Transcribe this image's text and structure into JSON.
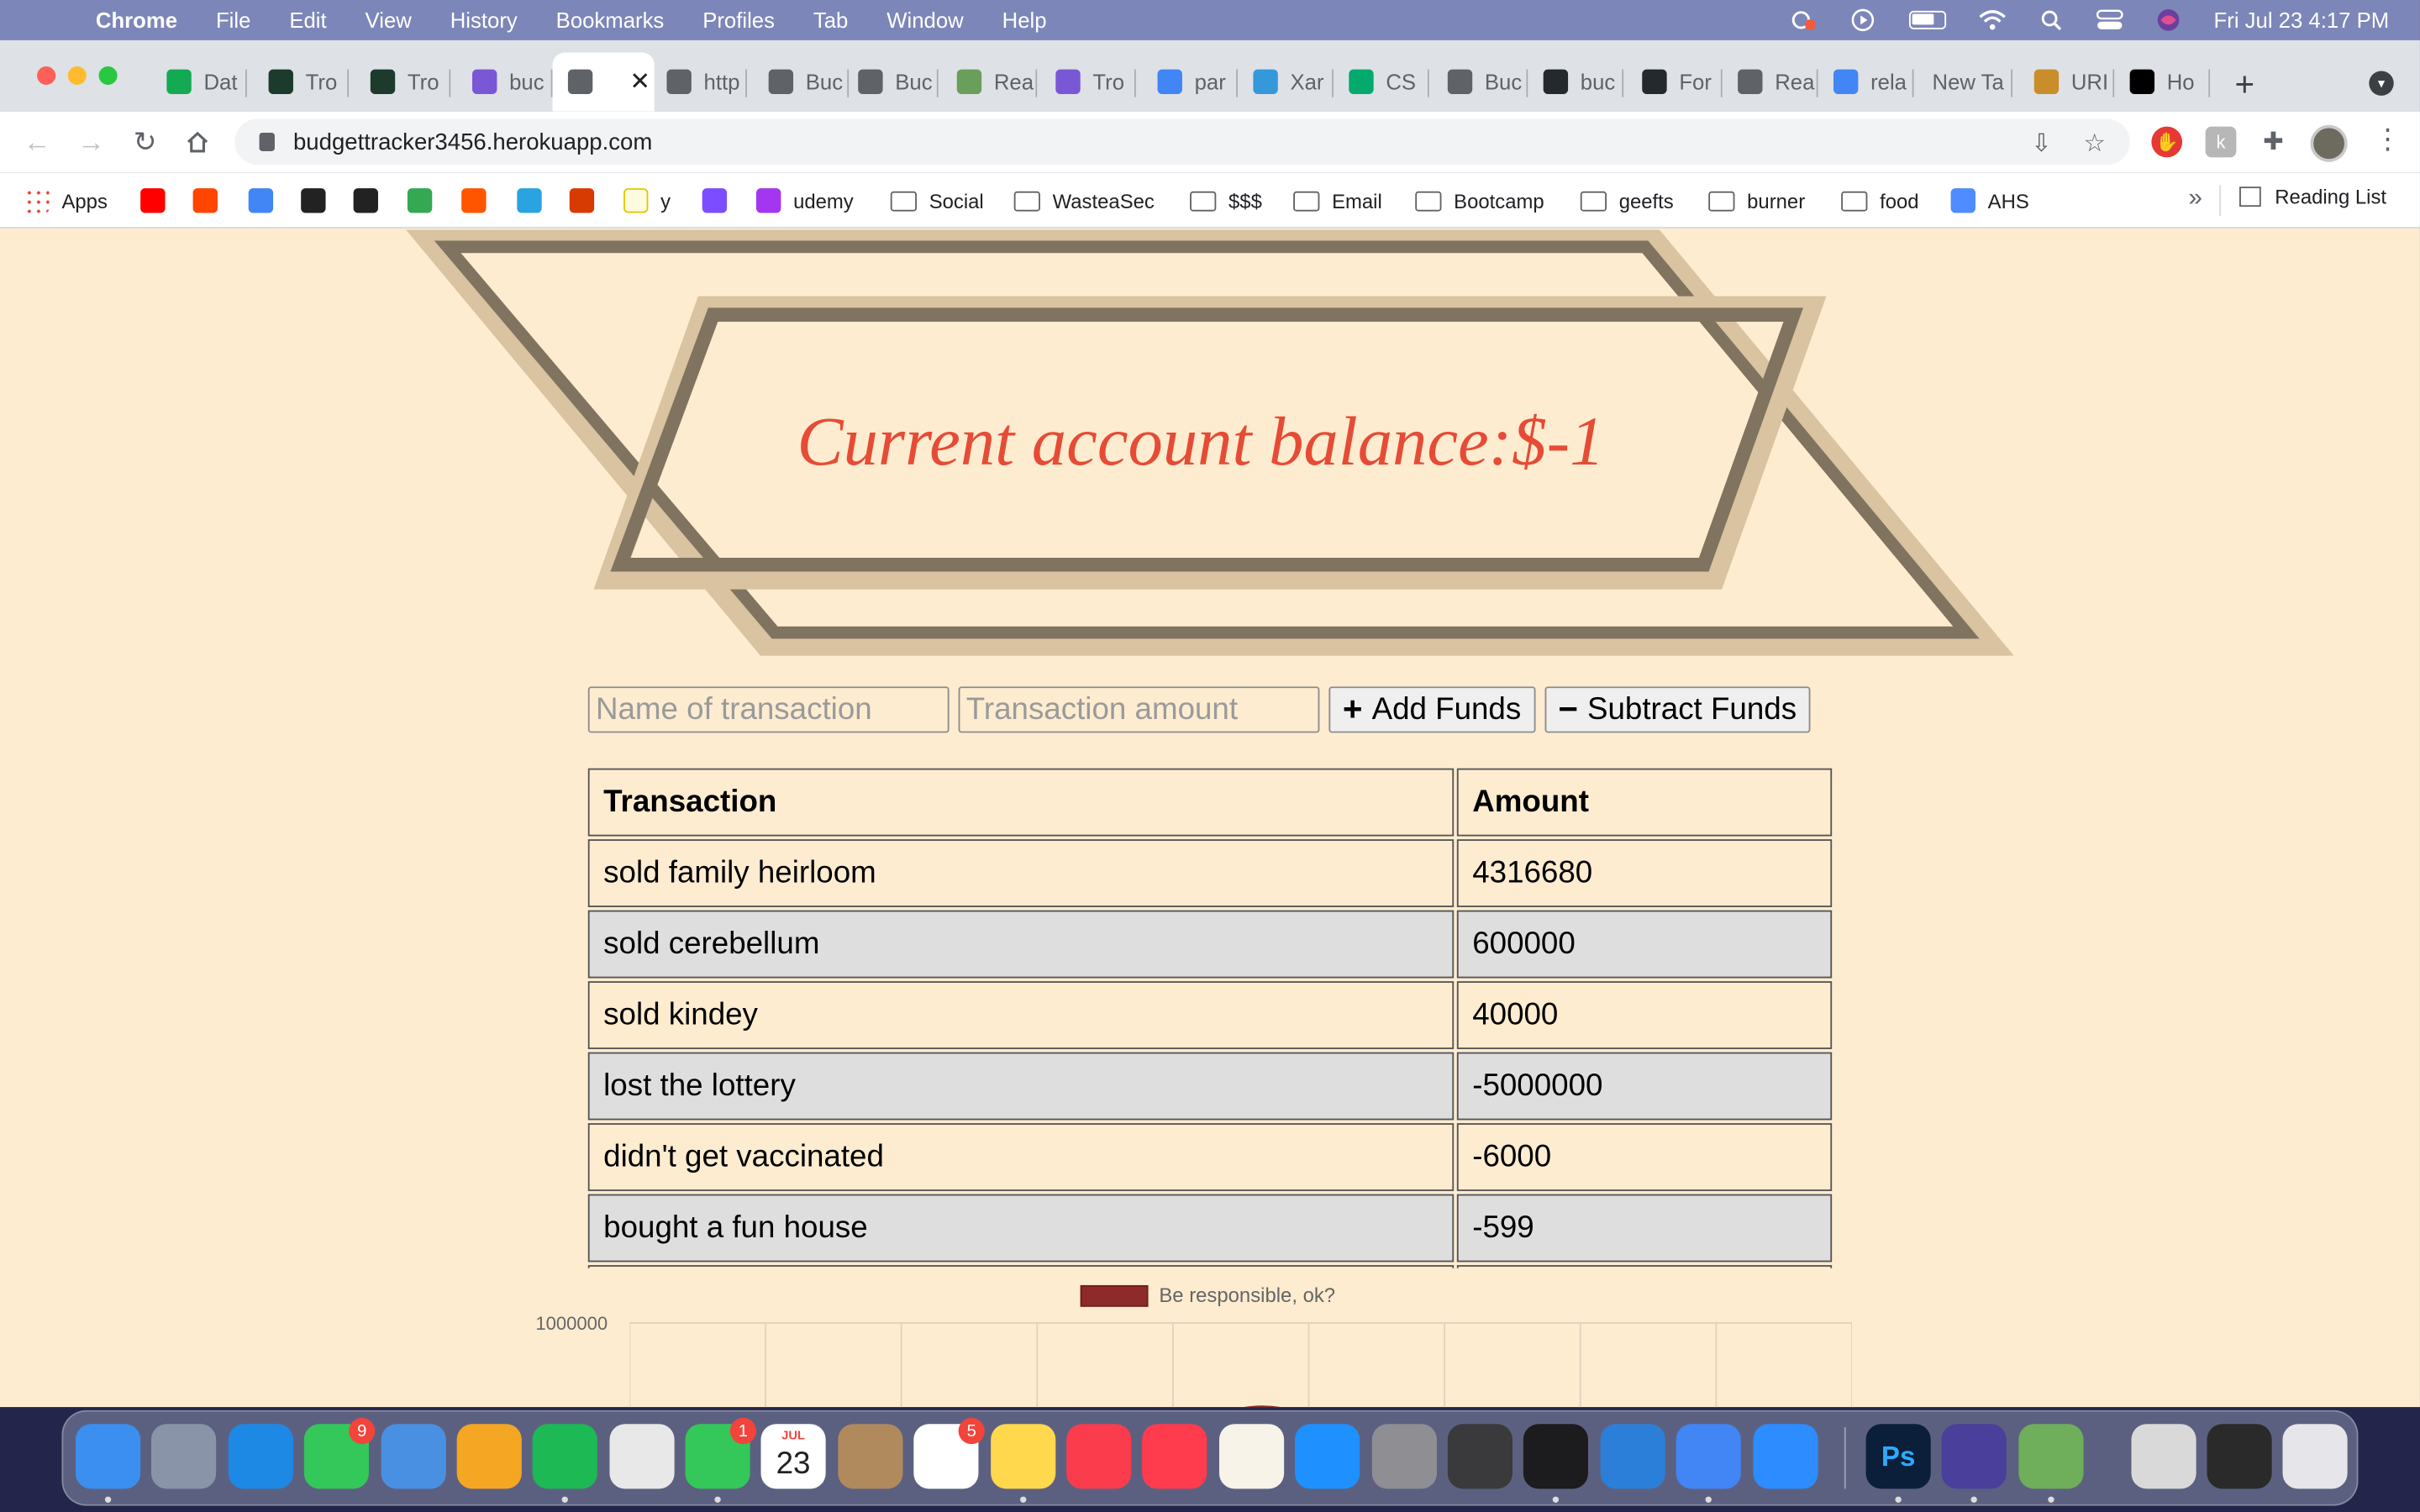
{
  "menubar": {
    "app": "Chrome",
    "items": [
      "File",
      "Edit",
      "View",
      "History",
      "Bookmarks",
      "Profiles",
      "Tab",
      "Window",
      "Help"
    ],
    "clock": "Fri Jul 23  4:17 PM"
  },
  "tabs": [
    {
      "label": "Dat",
      "fav": "mongodb-icon",
      "color": "#13aa52"
    },
    {
      "label": "Tro",
      "fav": "mongodb-icon",
      "color": "#1d3b2c"
    },
    {
      "label": "Tro",
      "fav": "mongodb-icon",
      "color": "#1d3b2c"
    },
    {
      "label": "buc",
      "fav": "heroku-icon",
      "color": "#7957d5"
    },
    {
      "label": "",
      "fav": "page-icon",
      "color": "#5f6368",
      "active": true
    },
    {
      "label": "http",
      "fav": "globe-icon",
      "color": "#5f6368"
    },
    {
      "label": "Buc",
      "fav": "page-icon",
      "color": "#5f6368"
    },
    {
      "label": "Buc",
      "fav": "page-icon",
      "color": "#5f6368"
    },
    {
      "label": "Rea",
      "fav": "fw-icon",
      "color": "#6a9e5b"
    },
    {
      "label": "Tro",
      "fav": "heroku-icon",
      "color": "#7957d5"
    },
    {
      "label": "par",
      "fav": "google-icon",
      "color": "#4285f4"
    },
    {
      "label": "Xar",
      "fav": "xamarin-icon",
      "color": "#3498db"
    },
    {
      "label": "CS",
      "fav": "w3schools-icon",
      "color": "#04aa6d"
    },
    {
      "label": "Buc",
      "fav": "page-icon",
      "color": "#5f6368"
    },
    {
      "label": "buc",
      "fav": "github-icon",
      "color": "#24292e"
    },
    {
      "label": "For",
      "fav": "github-icon",
      "color": "#24292e"
    },
    {
      "label": "Rea",
      "fav": "globe-icon",
      "color": "#5f6368"
    },
    {
      "label": "rela",
      "fav": "google-icon",
      "color": "#4285f4"
    },
    {
      "label": "New Ta",
      "fav": "",
      "color": ""
    },
    {
      "label": "URI",
      "fav": "uri-icon",
      "color": "#c98d2a"
    },
    {
      "label": "Ho",
      "fav": "dev-icon",
      "color": "#000000"
    }
  ],
  "address": {
    "url": "budgettracker3456.herokuapp.com"
  },
  "bookmarks": [
    {
      "label": "Apps",
      "kind": "apps-icon"
    },
    {
      "label": "",
      "kind": "youtube-icon",
      "color": "#ff0000"
    },
    {
      "label": "",
      "kind": "reddit-icon",
      "color": "#ff4500"
    },
    {
      "label": "",
      "kind": "calendar-icon",
      "color": "#4285f4"
    },
    {
      "label": "",
      "kind": "target-icon",
      "color": "#222222"
    },
    {
      "label": "",
      "kind": "amazon-icon",
      "color": "#222222"
    },
    {
      "label": "",
      "kind": "drive-icon",
      "color": "#34a853"
    },
    {
      "label": "",
      "kind": "soundcloud-icon",
      "color": "#ff5500"
    },
    {
      "label": "",
      "kind": "stripe-icon",
      "color": "#2aa4e0"
    },
    {
      "label": "",
      "kind": "office-icon",
      "color": "#d83b01"
    },
    {
      "label": "y",
      "kind": "blank-icon",
      "color": "#ffee55"
    },
    {
      "label": "",
      "kind": "books-icon",
      "color": "#7c4dff"
    },
    {
      "label": "udemy",
      "kind": "udemy-icon",
      "color": "#a435f0"
    },
    {
      "label": "Social",
      "kind": "folder"
    },
    {
      "label": "WasteaSec",
      "kind": "folder"
    },
    {
      "label": "$$$",
      "kind": "folder"
    },
    {
      "label": "Email",
      "kind": "folder"
    },
    {
      "label": "Bootcamp",
      "kind": "folder"
    },
    {
      "label": "geefts",
      "kind": "folder"
    },
    {
      "label": "burner",
      "kind": "folder"
    },
    {
      "label": "food",
      "kind": "folder"
    },
    {
      "label": "AHS",
      "kind": "pt-icon",
      "color": "#4e8cff"
    }
  ],
  "bookmarks_more": "»",
  "reading_list": "Reading List",
  "app": {
    "balance": "Current account balance:$-1",
    "name_placeholder": "Name of transaction",
    "amount_placeholder": "Transaction amount",
    "add_label": "Add Funds",
    "subtract_label": "Subtract Funds",
    "columns": [
      "Transaction",
      "Amount"
    ],
    "rows": [
      {
        "name": "sold family heirloom",
        "amount": "4316680"
      },
      {
        "name": "sold cerebellum",
        "amount": "600000"
      },
      {
        "name": "sold kindey",
        "amount": "40000"
      },
      {
        "name": "lost the lottery",
        "amount": "-5000000"
      },
      {
        "name": "didn't get vaccinated",
        "amount": "-6000"
      },
      {
        "name": "bought a fun house",
        "amount": "-599"
      }
    ],
    "legend": "Be responsible, ok?",
    "legend_color": "#8e2a2a",
    "y_top_tick": "1000000"
  },
  "dock": {
    "apps": [
      {
        "name": "finder-icon",
        "color": "#3b8ff0"
      },
      {
        "name": "launchpad-icon",
        "color": "#8a94a8"
      },
      {
        "name": "safari-icon",
        "color": "#1e88e5"
      },
      {
        "name": "messages-icon",
        "color": "#34c759",
        "badge": "9"
      },
      {
        "name": "mail-icon",
        "color": "#4a90e2"
      },
      {
        "name": "photos-icon",
        "color": "#f5a623"
      },
      {
        "name": "spotify-icon",
        "color": "#1db954"
      },
      {
        "name": "slack-icon",
        "color": "#e8e8e8"
      },
      {
        "name": "facetime-icon",
        "color": "#34c759",
        "badge": "1"
      },
      {
        "name": "calendar-icon",
        "color": "#ffffff",
        "text": "23",
        "small": "JUL"
      },
      {
        "name": "contacts-icon",
        "color": "#b08a5c"
      },
      {
        "name": "reminders-icon",
        "color": "#ffffff",
        "badge": "5"
      },
      {
        "name": "notes-icon",
        "color": "#ffd84d"
      },
      {
        "name": "music-icon",
        "color": "#fa3c4c"
      },
      {
        "name": "news-icon",
        "color": "#ff3b4e"
      },
      {
        "name": "pages-icon",
        "color": "#f7f3e8"
      },
      {
        "name": "app-store-icon",
        "color": "#1e90ff"
      },
      {
        "name": "system-preferences-icon",
        "color": "#8e8e93"
      },
      {
        "name": "garageband-icon",
        "color": "#3a3a3c"
      },
      {
        "name": "terminal-icon",
        "color": "#1c1c1e"
      },
      {
        "name": "vscode-icon",
        "color": "#2b7fd9"
      },
      {
        "name": "chrome-icon",
        "color": "#4285f4"
      },
      {
        "name": "zoom-icon",
        "color": "#2d8cff"
      },
      {
        "name": "photoshop-icon",
        "color": "#0b1f3a",
        "text": "Ps"
      },
      {
        "name": "moon-app-icon",
        "color": "#4a3f9b"
      },
      {
        "name": "rocket-app-icon",
        "color": "#6fae5a"
      },
      {
        "name": "downloads-stack-icon",
        "color": "#d9d9d9"
      },
      {
        "name": "screen-recording-icon",
        "color": "#2a2a2a"
      },
      {
        "name": "trash-icon",
        "color": "#e5e5ea"
      }
    ]
  }
}
